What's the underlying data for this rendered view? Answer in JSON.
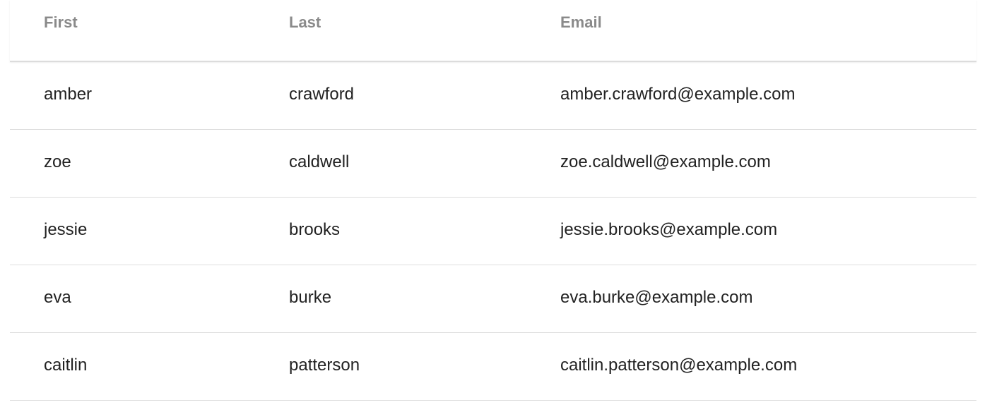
{
  "table": {
    "columns": {
      "first": "First",
      "last": "Last",
      "email": "Email"
    },
    "rows": [
      {
        "first": "amber",
        "last": "crawford",
        "email": "amber.crawford@example.com"
      },
      {
        "first": "zoe",
        "last": "caldwell",
        "email": "zoe.caldwell@example.com"
      },
      {
        "first": "jessie",
        "last": "brooks",
        "email": "jessie.brooks@example.com"
      },
      {
        "first": "eva",
        "last": "burke",
        "email": "eva.burke@example.com"
      },
      {
        "first": "caitlin",
        "last": "patterson",
        "email": "caitlin.patterson@example.com"
      }
    ]
  },
  "colors": {
    "header_text": "#8a8a8a",
    "cell_text": "#222222",
    "divider": "#dddddd"
  }
}
